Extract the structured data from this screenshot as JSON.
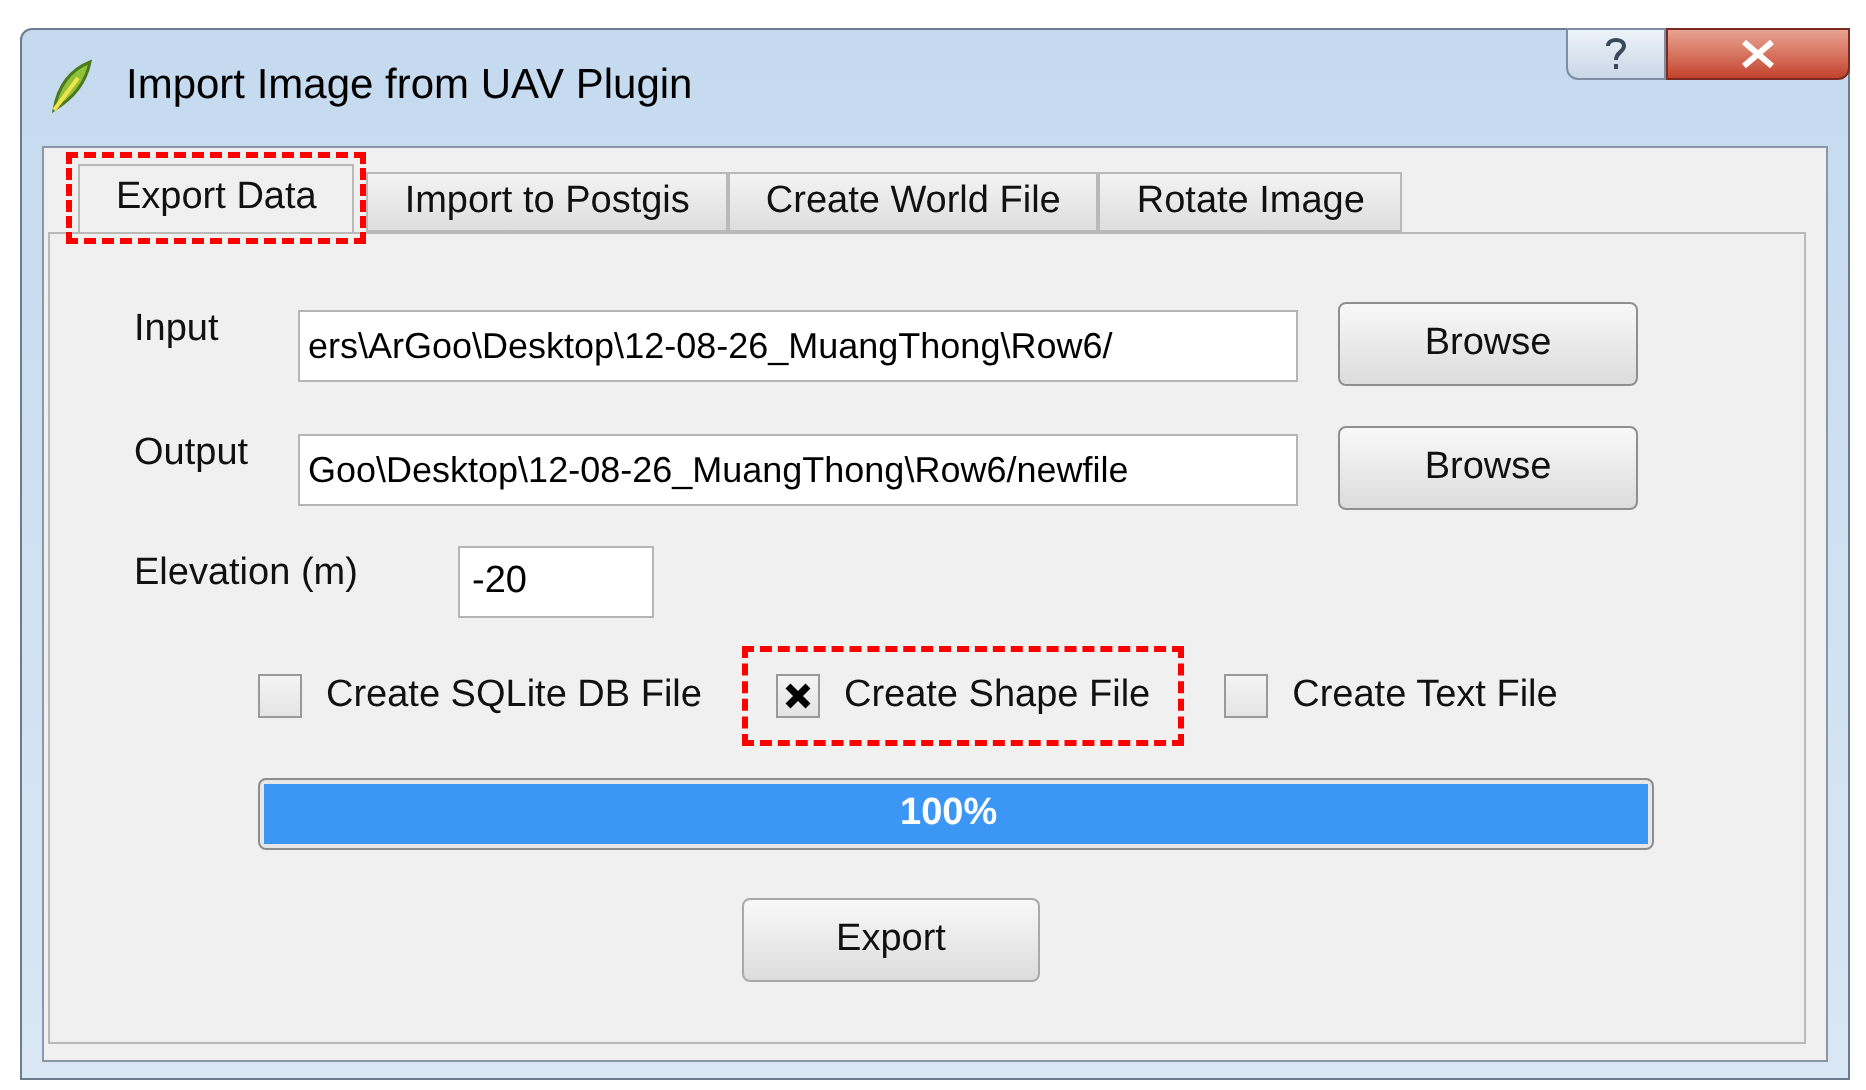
{
  "window": {
    "title": "Import Image from UAV Plugin"
  },
  "tabs": [
    {
      "label": "Export Data",
      "selected": true,
      "highlighted": true
    },
    {
      "label": "Import to Postgis",
      "selected": false,
      "highlighted": false
    },
    {
      "label": "Create World File",
      "selected": false,
      "highlighted": false
    },
    {
      "label": "Rotate Image",
      "selected": false,
      "highlighted": false
    }
  ],
  "fields": [
    {
      "label": "Input",
      "value": "ers\\ArGoo\\Desktop\\12-08-26_MuangThong\\Row6/",
      "button": "Browse"
    },
    {
      "label": "Output",
      "value": "Goo\\Desktop\\12-08-26_MuangThong\\Row6/newfile",
      "button": "Browse"
    }
  ],
  "elevation": {
    "label": "Elevation (m)",
    "value": "-20"
  },
  "checkboxes": [
    {
      "label": "Create SQLite DB File",
      "checked": false,
      "highlighted": false
    },
    {
      "label": "Create Shape File",
      "checked": true,
      "highlighted": true
    },
    {
      "label": "Create Text File",
      "checked": false,
      "highlighted": false
    }
  ],
  "progress": {
    "level": 1,
    "reading": "100%"
  },
  "export_button": "Export"
}
